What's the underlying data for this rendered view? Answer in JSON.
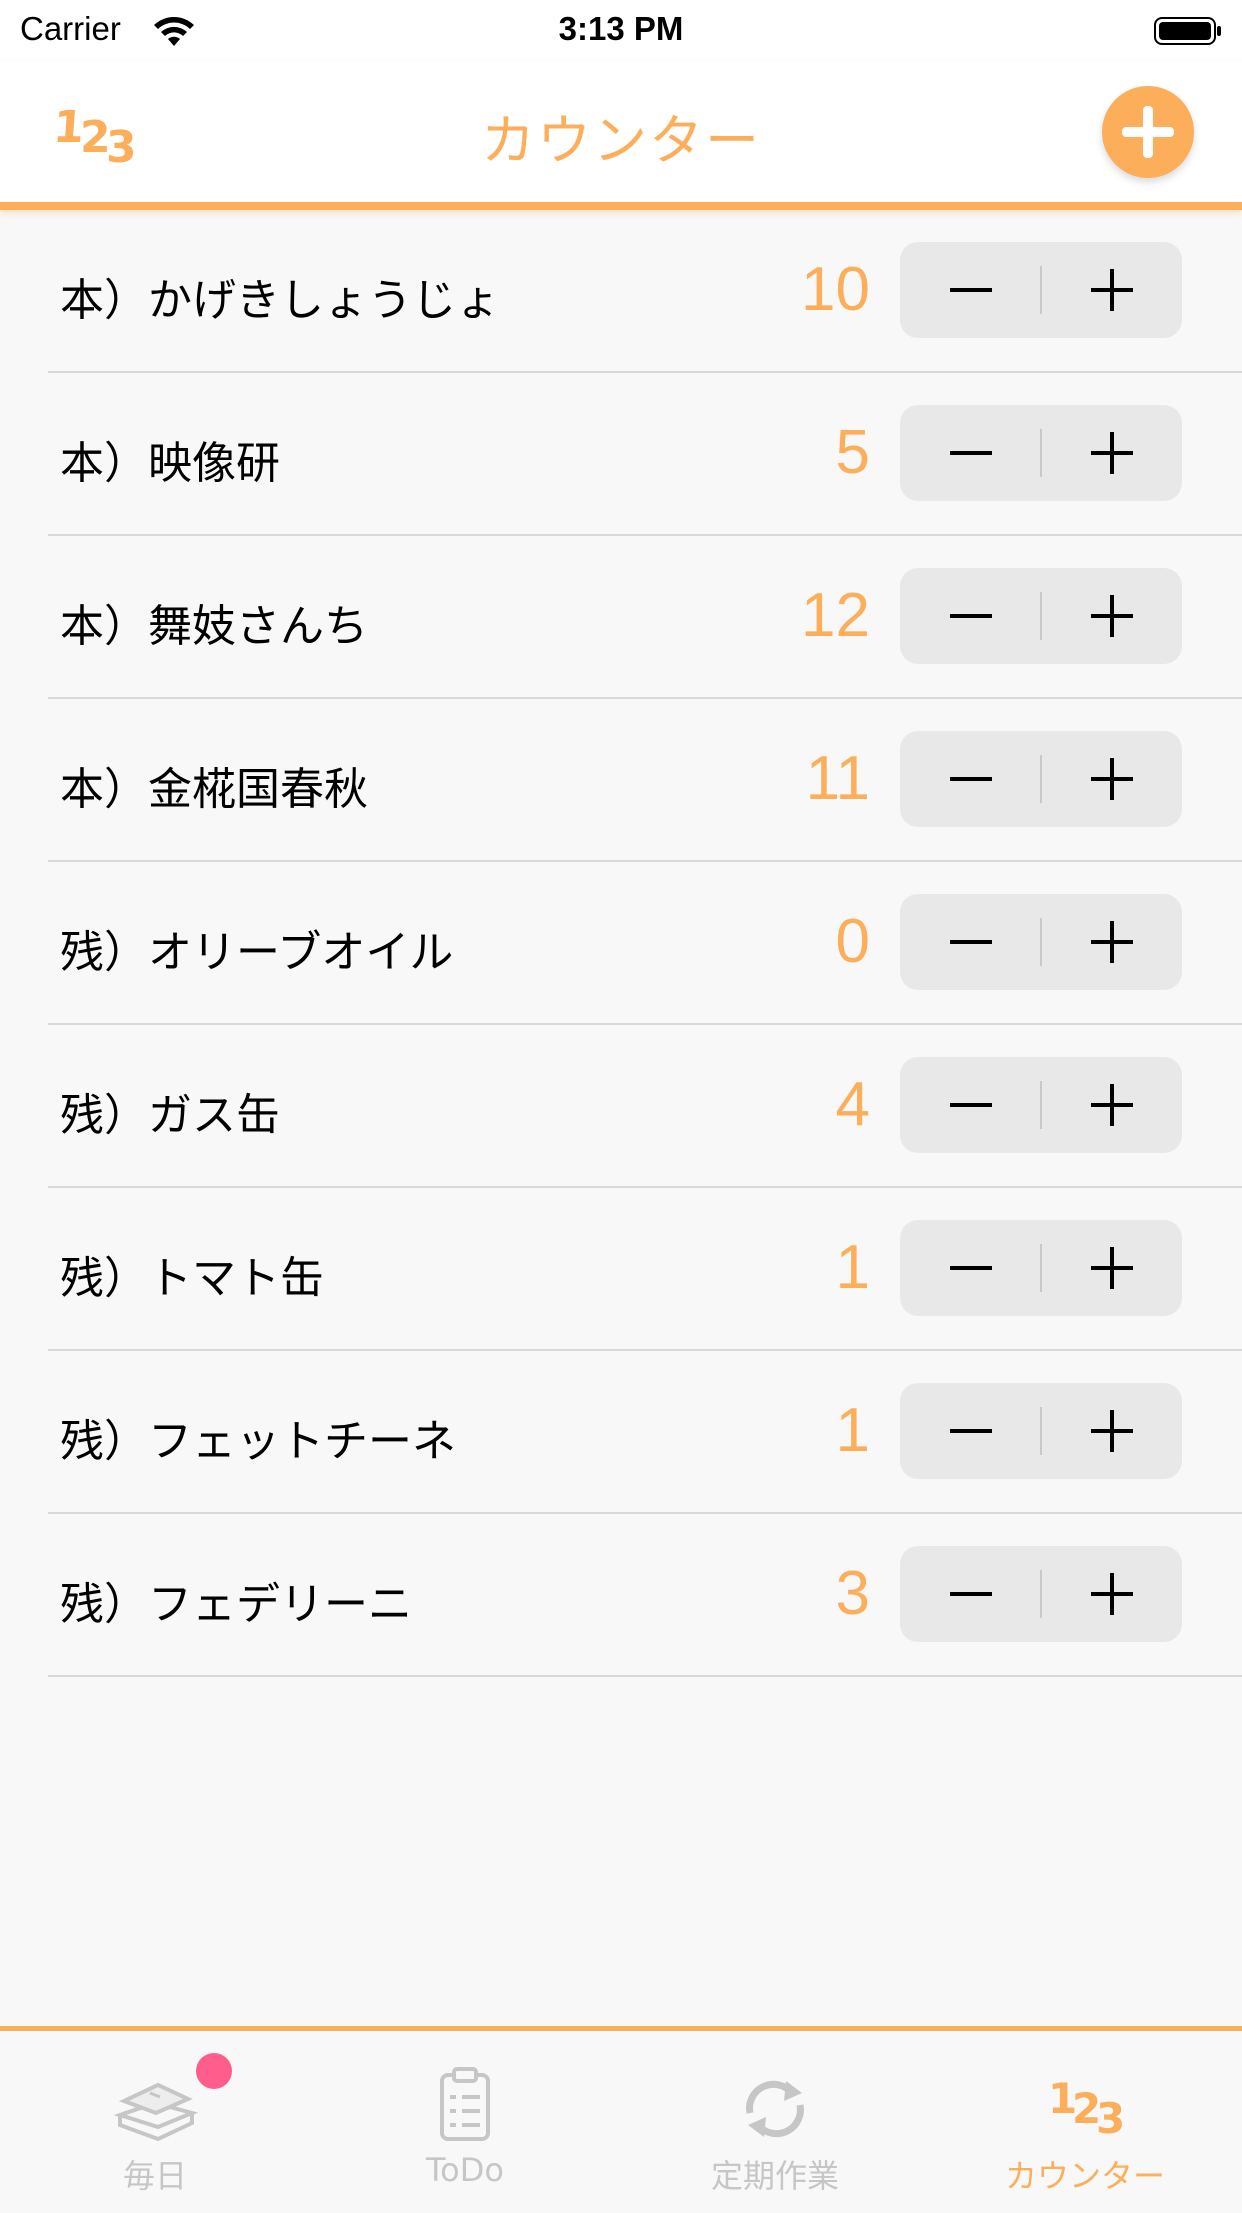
{
  "status_bar": {
    "carrier": "Carrier",
    "time": "3:13 PM"
  },
  "nav": {
    "title": "カウンター",
    "logo_text": "123",
    "add_icon": "plus-circle-icon"
  },
  "counters": [
    {
      "label": "本）かげきしょうじょ",
      "count": "10"
    },
    {
      "label": "本）映像研",
      "count": "5"
    },
    {
      "label": "本）舞妓さんち",
      "count": "12"
    },
    {
      "label": "本）金椛国春秋",
      "count": "11"
    },
    {
      "label": "残）オリーブオイル",
      "count": "0"
    },
    {
      "label": "残）ガス缶",
      "count": "4"
    },
    {
      "label": "残）トマト缶",
      "count": "1"
    },
    {
      "label": "残）フェットチーネ",
      "count": "1"
    },
    {
      "label": "残）フェデリーニ",
      "count": "3"
    }
  ],
  "tabs": [
    {
      "label": "毎日",
      "icon": "book-stack-icon",
      "active": false,
      "badge": true
    },
    {
      "label": "ToDo",
      "icon": "clipboard-list-icon",
      "active": false,
      "badge": false
    },
    {
      "label": "定期作業",
      "icon": "repeat-arrows-icon",
      "active": false,
      "badge": false
    },
    {
      "label": "カウンター",
      "icon": "counter-123-icon",
      "active": true,
      "badge": false
    }
  ],
  "colors": {
    "accent": "#FDAE5A",
    "badge": "#FF5E8C",
    "inactive_tab": "#C6C6C6",
    "stepper_bg": "#E8E8E8"
  }
}
